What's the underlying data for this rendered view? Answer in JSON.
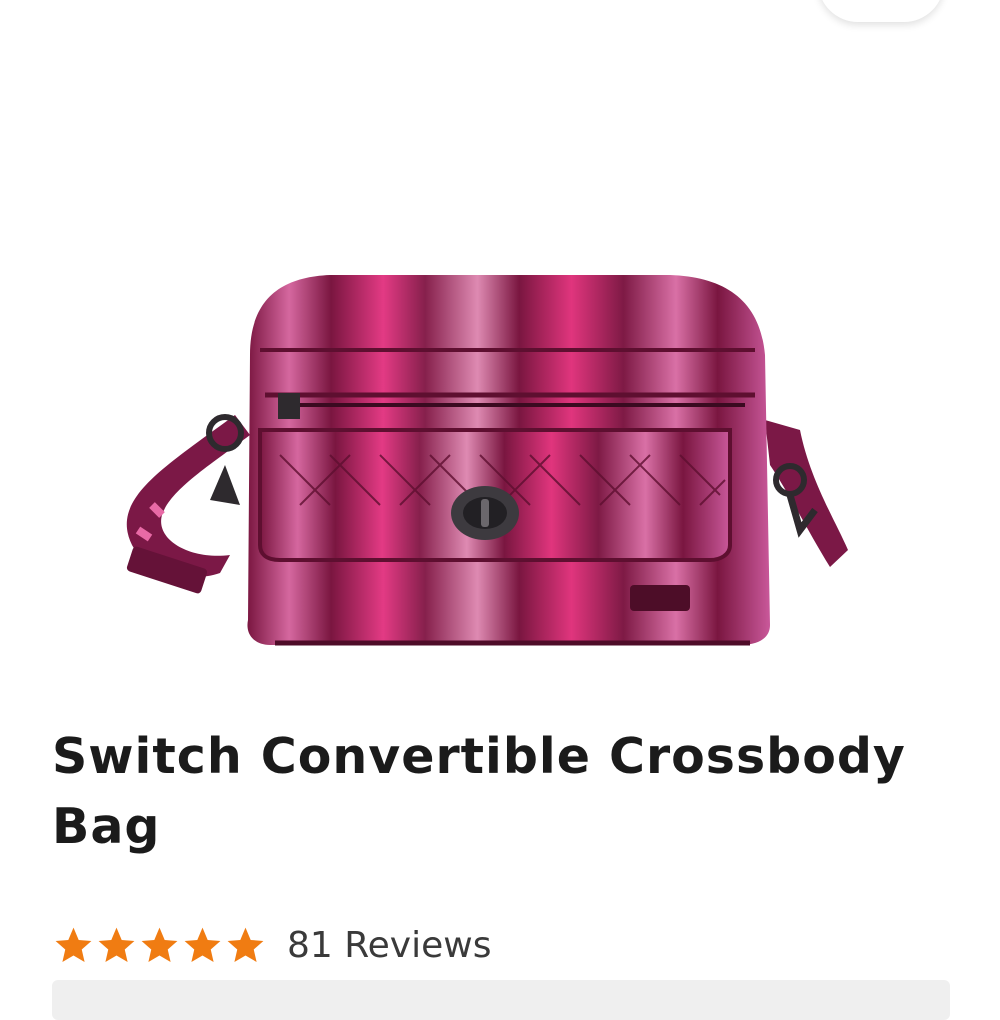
{
  "product": {
    "title": "Switch Convertible Crossbody Bag",
    "image_icon": "crossbody-bag-image"
  },
  "rating": {
    "stars": 5,
    "max_stars": 5,
    "review_count_label": "81 Reviews"
  },
  "colors": {
    "star": "#f07c12",
    "title": "#1b1b1b",
    "bag_base": "#7a1640",
    "bag_pink": "#e4357f"
  }
}
